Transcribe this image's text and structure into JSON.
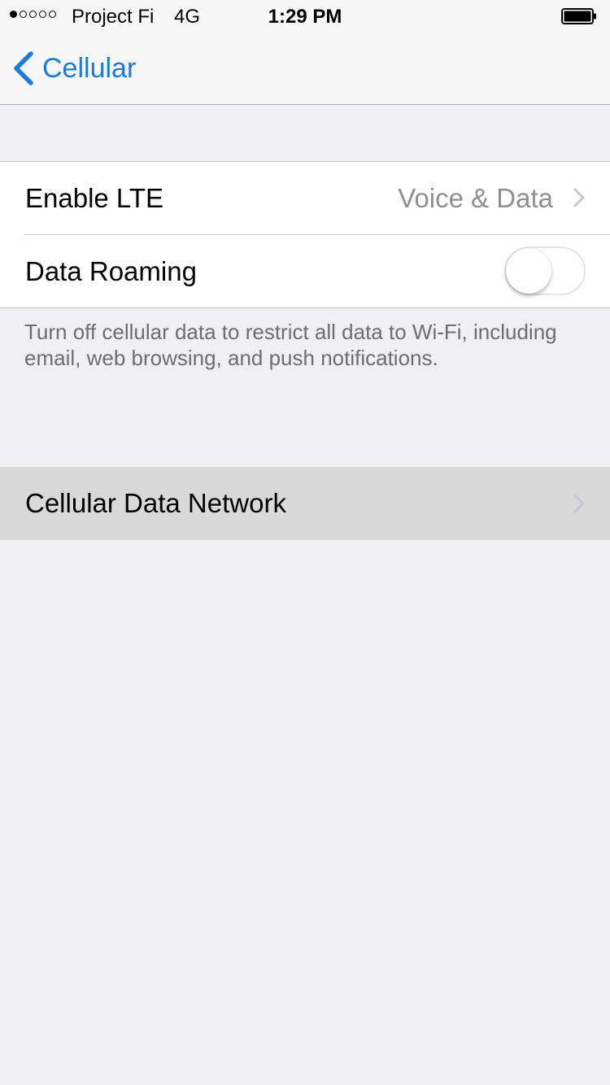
{
  "status_bar": {
    "signal_dots": [
      true,
      false,
      false,
      false,
      false
    ],
    "carrier": "Project Fi",
    "network": "4G",
    "time": "1:29 PM",
    "battery_level": 1.0
  },
  "nav": {
    "back_label": "Cellular"
  },
  "settings": {
    "enable_lte": {
      "label": "Enable LTE",
      "value": "Voice & Data"
    },
    "data_roaming": {
      "label": "Data Roaming",
      "enabled": false
    },
    "footer_note": "Turn off cellular data to restrict all data to Wi-Fi, including email, web browsing, and push notifications.",
    "cellular_data_network": {
      "label": "Cellular Data Network"
    }
  },
  "colors": {
    "accent": "#1c7cd5",
    "background": "#efeff4",
    "secondary_text": "#8e8e93",
    "highlight_row": "#d9d9d9"
  },
  "icons": {
    "back": "chevron-left-icon",
    "disclosure": "chevron-right-icon",
    "battery": "battery-icon"
  }
}
